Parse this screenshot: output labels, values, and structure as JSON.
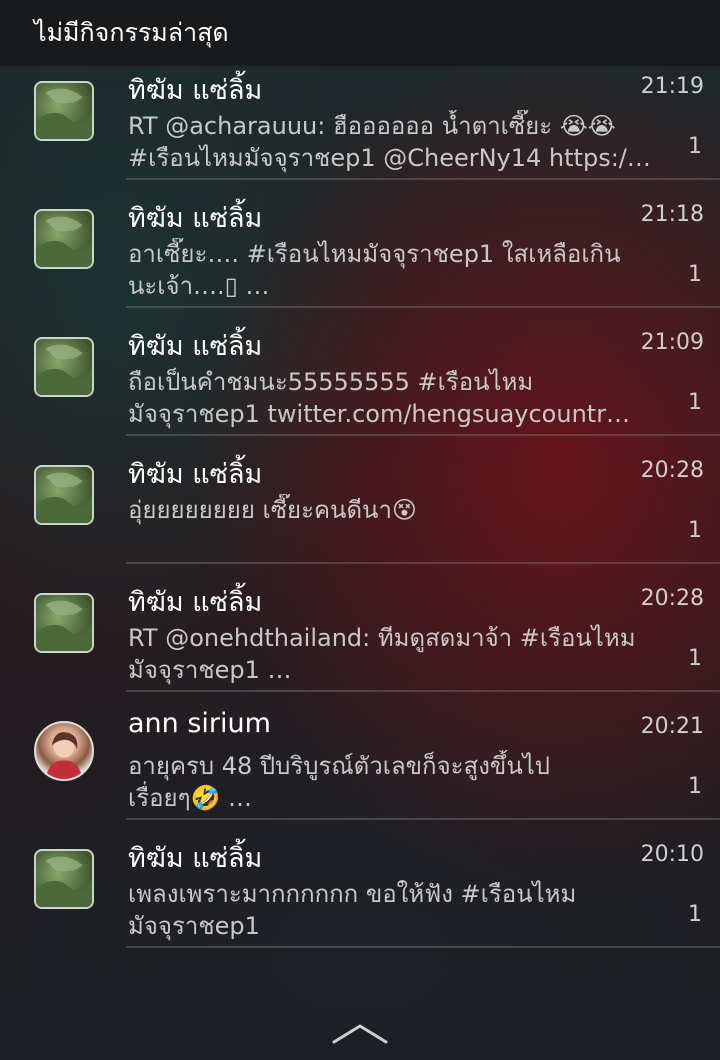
{
  "header": {
    "title": "ไม่มีกิจกรรมล่าสุด"
  },
  "notifications": [
    {
      "name": "ทิฆัม แซ่ลิ้ม",
      "time": "21:19",
      "text": "RT @acharauuu: ฮืออออออ น้ำตาเซี๊ยะ 😭😭\n#เรือนไหมมัจจุราชep1 @CheerNy14 https:/…",
      "count": "1",
      "avatar": "landscape-avatar"
    },
    {
      "name": "ทิฆัม แซ่ลิ้ม",
      "time": "21:18",
      "text": "อาเซี๊ยะ…. #เรือนไหมมัจจุราชep1 ใสเหลือเกิน\nนะเจ้า….▯ …",
      "count": "1",
      "avatar": "landscape-avatar"
    },
    {
      "name": "ทิฆัม แซ่ลิ้ม",
      "time": "21:09",
      "text": "ถือเป็นคำชมนะ55555555 #เรือนไหม\nมัจจุราชep1 twitter.com/hengsuaycountr…",
      "count": "1",
      "avatar": "landscape-avatar"
    },
    {
      "name": "ทิฆัม แซ่ลิ้ม",
      "time": "20:28",
      "text": "อุ่ยยยยยยยย เซี๊ยะคนดีนา😵",
      "count": "1",
      "avatar": "landscape-avatar"
    },
    {
      "name": "ทิฆัม แซ่ลิ้ม",
      "time": "20:28",
      "text": "RT @onehdthailand: ทีมดูสดมาจ้า #เรือนไหม\nมัจจุราชep1 …",
      "count": "1",
      "avatar": "landscape-avatar"
    },
    {
      "name": "ann sirium",
      "time": "20:21",
      "text": "อายุครบ 48 ปีบริบูรณ์ตัวเลขก็จะสูงขึ้นไป\nเรื่อยๆ🤣 …",
      "count": "1",
      "avatar": "person-avatar"
    },
    {
      "name": "ทิฆัม แซ่ลิ้ม",
      "time": "20:10",
      "text": "เพลงเพราะมากกกกกก ขอให้ฟัง #เรือนไหม\nมัจจุราชep1",
      "count": "1",
      "avatar": "landscape-avatar"
    }
  ],
  "footer": {
    "icon": "chevron-up-icon"
  }
}
